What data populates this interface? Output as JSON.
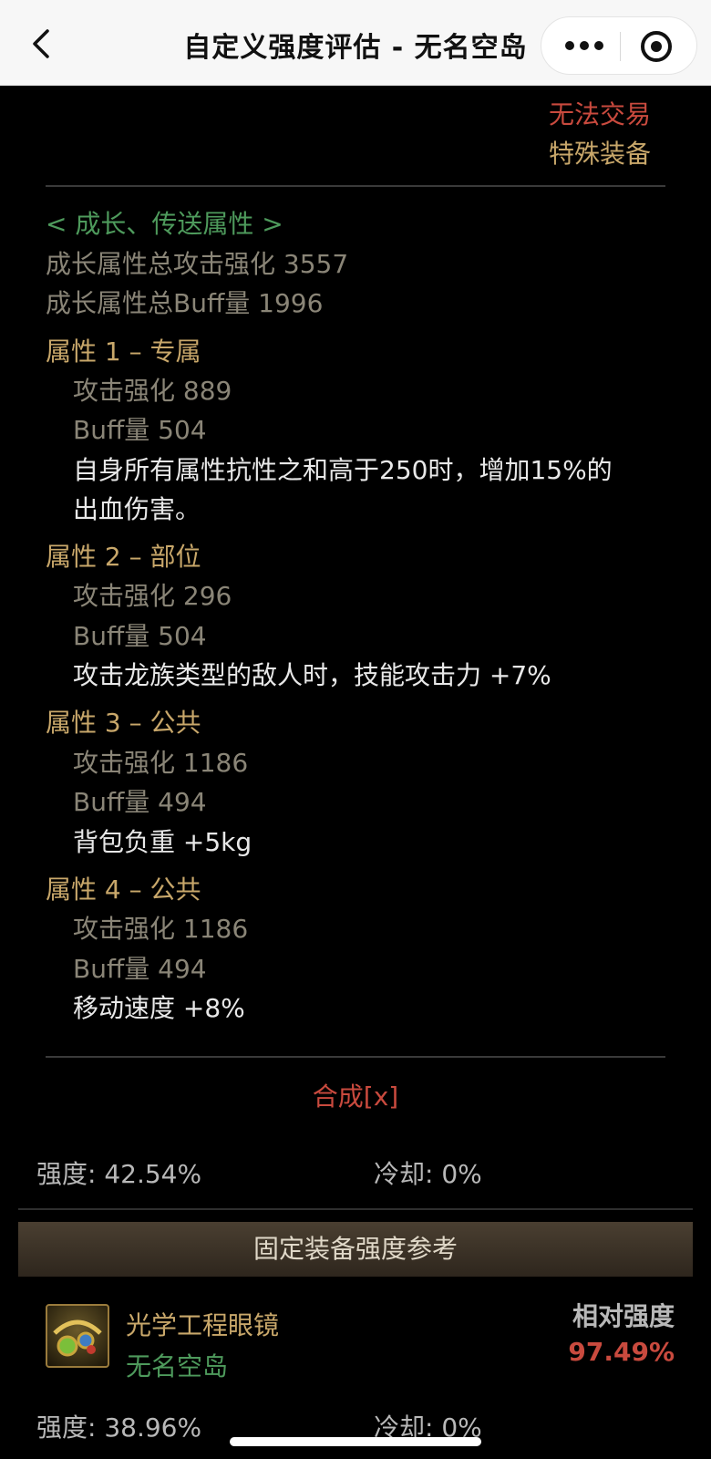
{
  "nav": {
    "title": "自定义强度评估 - 无名空岛",
    "back_icon": "chevron-left-icon",
    "more_icon": "more-dots-icon",
    "close_icon": "target-circle-icon"
  },
  "tags": {
    "trade": "无法交易",
    "type": "特殊装备"
  },
  "growth": {
    "header": "< 成长、传送属性 >",
    "total_attack": "成长属性总攻击强化 3557",
    "total_buff": "成长属性总Buff量 1996"
  },
  "attributes": [
    {
      "title": "属性 1 – 专属",
      "attack": "攻击强化   889",
      "buff": "Buff量   504",
      "effect": [
        "自身所有属性抗性之和高于250时，增加15%的",
        "出血伤害。"
      ]
    },
    {
      "title": "属性 2 – 部位",
      "attack": "攻击强化   296",
      "buff": "Buff量   504",
      "effect": [
        "攻击龙族类型的敌人时，技能攻击力 +7%"
      ]
    },
    {
      "title": "属性 3 – 公共",
      "attack": "攻击强化   1186",
      "buff": "Buff量   494",
      "effect": [
        "背包负重 +5kg"
      ]
    },
    {
      "title": "属性 4 – 公共",
      "attack": "攻击强化   1186",
      "buff": "Buff量   494",
      "effect": [
        "移动速度 +8%"
      ]
    }
  ],
  "synthesis": "合成[x]",
  "stats": {
    "strength": "强度: 42.54%",
    "cooldown": "冷却: 0%"
  },
  "reference": {
    "header": "固定装备强度参考",
    "item_name": "光学工程眼镜",
    "item_server": "无名空岛",
    "relative_label": "相对强度",
    "relative_value": "97.49%",
    "strength": "强度: 38.96%",
    "cooldown": "冷却: 0%"
  },
  "colors": {
    "red": "#c94a3e",
    "gold": "#c8a76a",
    "green": "#4e9a5c",
    "grey": "#8a8577"
  }
}
